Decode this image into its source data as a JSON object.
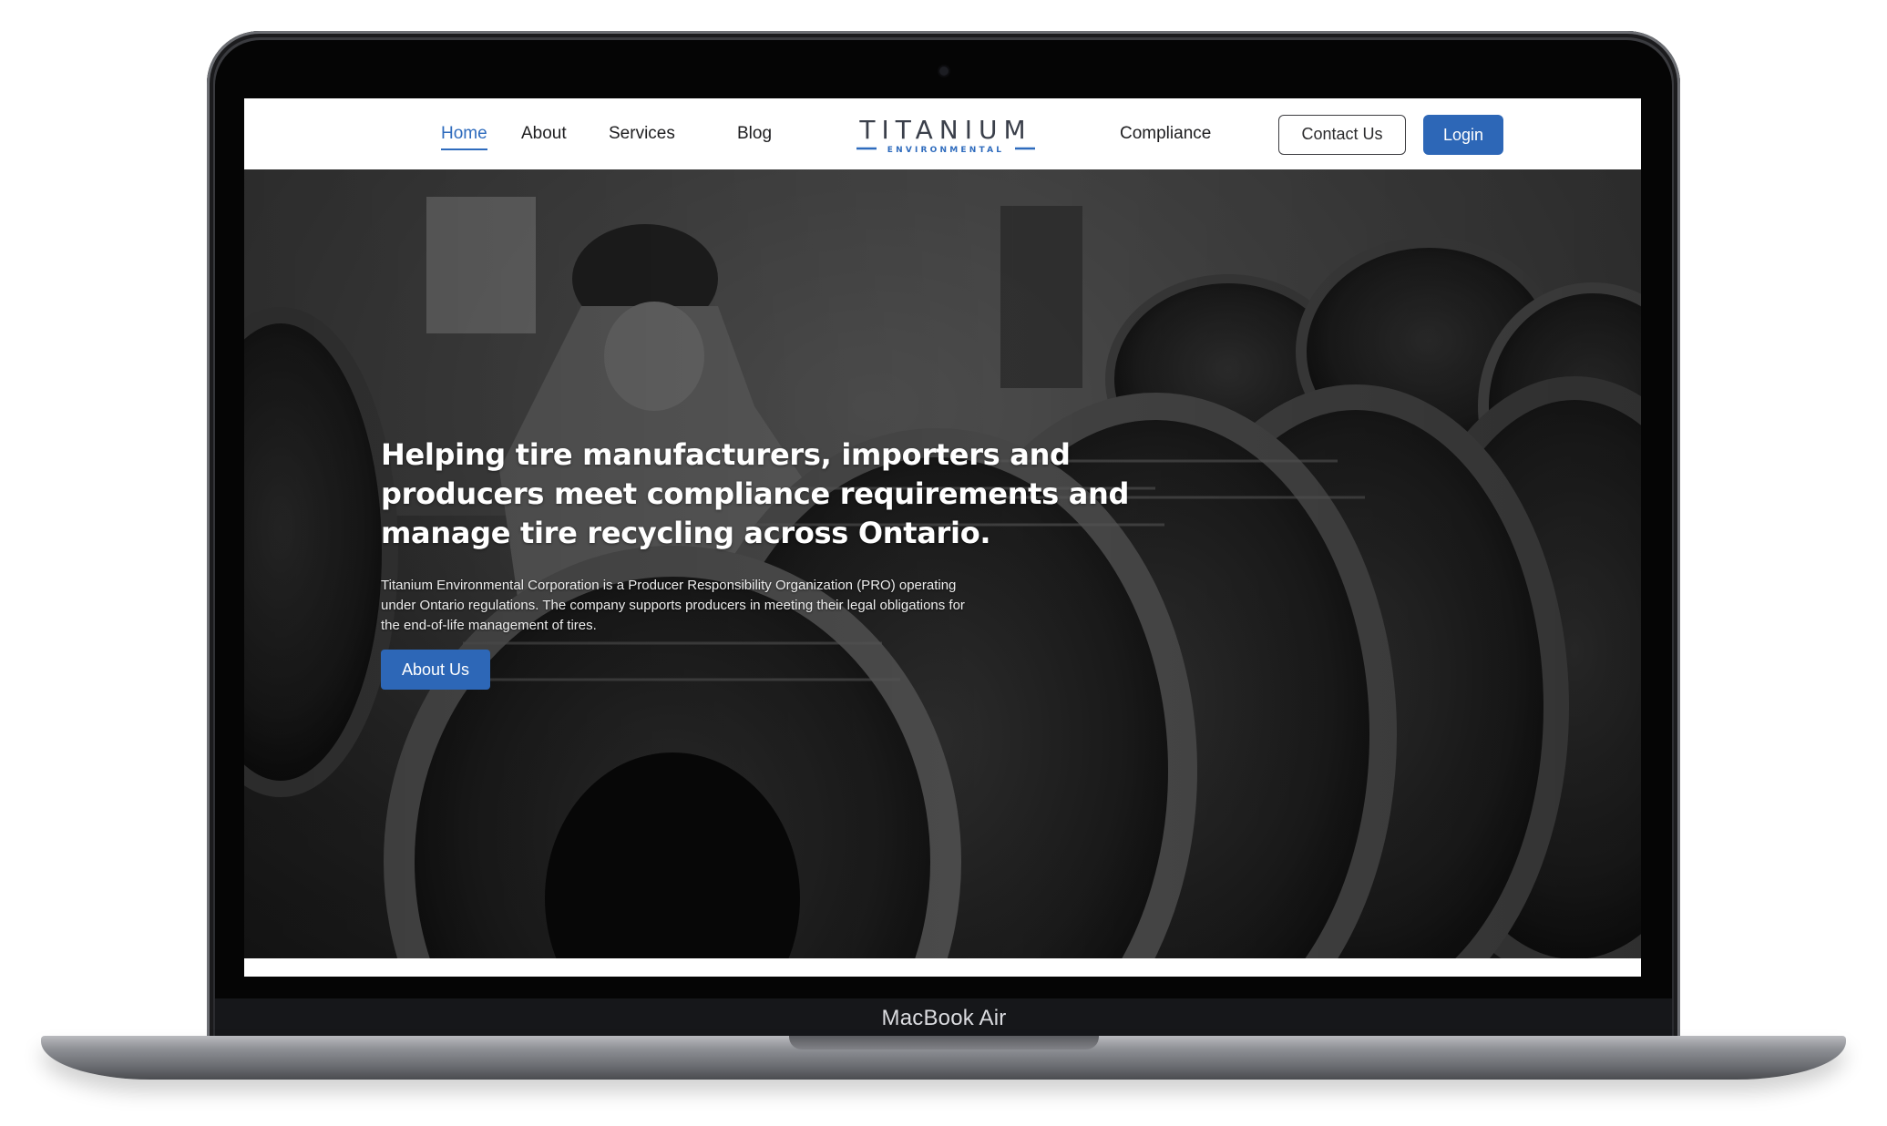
{
  "device": {
    "model_label": "MacBook Air"
  },
  "nav": {
    "links": [
      {
        "label": "Home",
        "active": true
      },
      {
        "label": "About",
        "active": false
      },
      {
        "label": "Services",
        "active": false
      },
      {
        "label": "Blog",
        "active": false
      }
    ],
    "compliance_label": "Compliance",
    "contact_label": "Contact Us",
    "login_label": "Login",
    "logo": {
      "wordmark": "TITANIUM",
      "tagline": "ENVIRONMENTAL"
    }
  },
  "hero": {
    "title": "Helping tire manufacturers, importers and producers meet compliance requirements and manage tire recycling across Ontario.",
    "body": "Titanium Environmental Corporation is a Producer Responsibility Organization (PRO) operating under Ontario regulations. The company supports producers in meeting their legal obligations for the end-of-life management of tires.",
    "button_label": "About Us"
  },
  "colors": {
    "accent": "#2d67b7",
    "nav_active": "#2e6bbd",
    "logo_dark": "#3a3f4a"
  }
}
